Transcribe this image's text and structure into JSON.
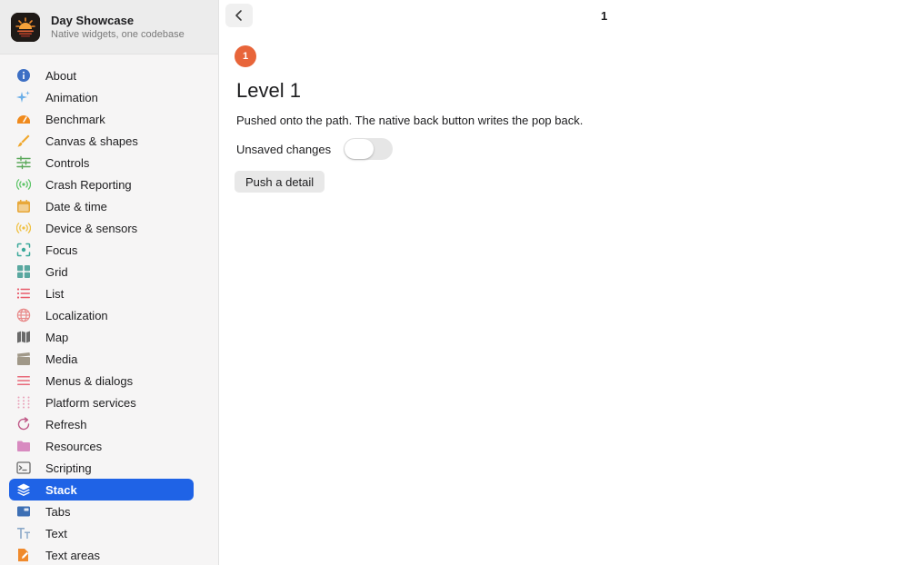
{
  "app": {
    "title": "Day Showcase",
    "subtitle": "Native widgets, one codebase"
  },
  "sidebar": {
    "items": [
      {
        "label": "About",
        "icon": "info-icon",
        "color": "#3d6fc4"
      },
      {
        "label": "Animation",
        "icon": "sparkles-icon",
        "color": "#6aaee8"
      },
      {
        "label": "Benchmark",
        "icon": "speedometer-icon",
        "color": "#f08a1c"
      },
      {
        "label": "Canvas & shapes",
        "icon": "paintbrush-icon",
        "color": "#f0a72c"
      },
      {
        "label": "Controls",
        "icon": "sliders-icon",
        "color": "#5aa85a"
      },
      {
        "label": "Crash Reporting",
        "icon": "broadcast-icon",
        "color": "#5cc466"
      },
      {
        "label": "Date & time",
        "icon": "calendar-icon",
        "color": "#e8a83a"
      },
      {
        "label": "Device & sensors",
        "icon": "sensor-icon",
        "color": "#f0c040"
      },
      {
        "label": "Focus",
        "icon": "focus-icon",
        "color": "#3aa89a"
      },
      {
        "label": "Grid",
        "icon": "grid-icon",
        "color": "#5aa8a0"
      },
      {
        "label": "List",
        "icon": "list-icon",
        "color": "#e85a6a"
      },
      {
        "label": "Localization",
        "icon": "globe-icon",
        "color": "#e88a8a"
      },
      {
        "label": "Map",
        "icon": "map-icon",
        "color": "#6a6a6a"
      },
      {
        "label": "Media",
        "icon": "clapperboard-icon",
        "color": "#a09888"
      },
      {
        "label": "Menus & dialogs",
        "icon": "menu-icon",
        "color": "#e86a7a"
      },
      {
        "label": "Platform services",
        "icon": "dots-grid-icon",
        "color": "#e8a0b8"
      },
      {
        "label": "Refresh",
        "icon": "refresh-icon",
        "color": "#c05a88"
      },
      {
        "label": "Resources",
        "icon": "folder-icon",
        "color": "#d88ac0"
      },
      {
        "label": "Scripting",
        "icon": "terminal-icon",
        "color": "#6a6a6a"
      },
      {
        "label": "Stack",
        "icon": "layers-icon",
        "color": "#ffffff",
        "active": true
      },
      {
        "label": "Tabs",
        "icon": "tabs-icon",
        "color": "#3d6fb4"
      },
      {
        "label": "Text",
        "icon": "text-icon",
        "color": "#8aa8c8"
      },
      {
        "label": "Text areas",
        "icon": "document-edit-icon",
        "color": "#f08a2c"
      }
    ]
  },
  "main": {
    "nav_title": "1",
    "badge": "1",
    "level_title": "Level 1",
    "description": "Pushed onto the path. The native back button writes the pop back.",
    "toggle_label": "Unsaved changes",
    "toggle_on": false,
    "push_button": "Push a detail"
  },
  "colors": {
    "accent": "#1f63e6",
    "badge": "#e8653a"
  }
}
